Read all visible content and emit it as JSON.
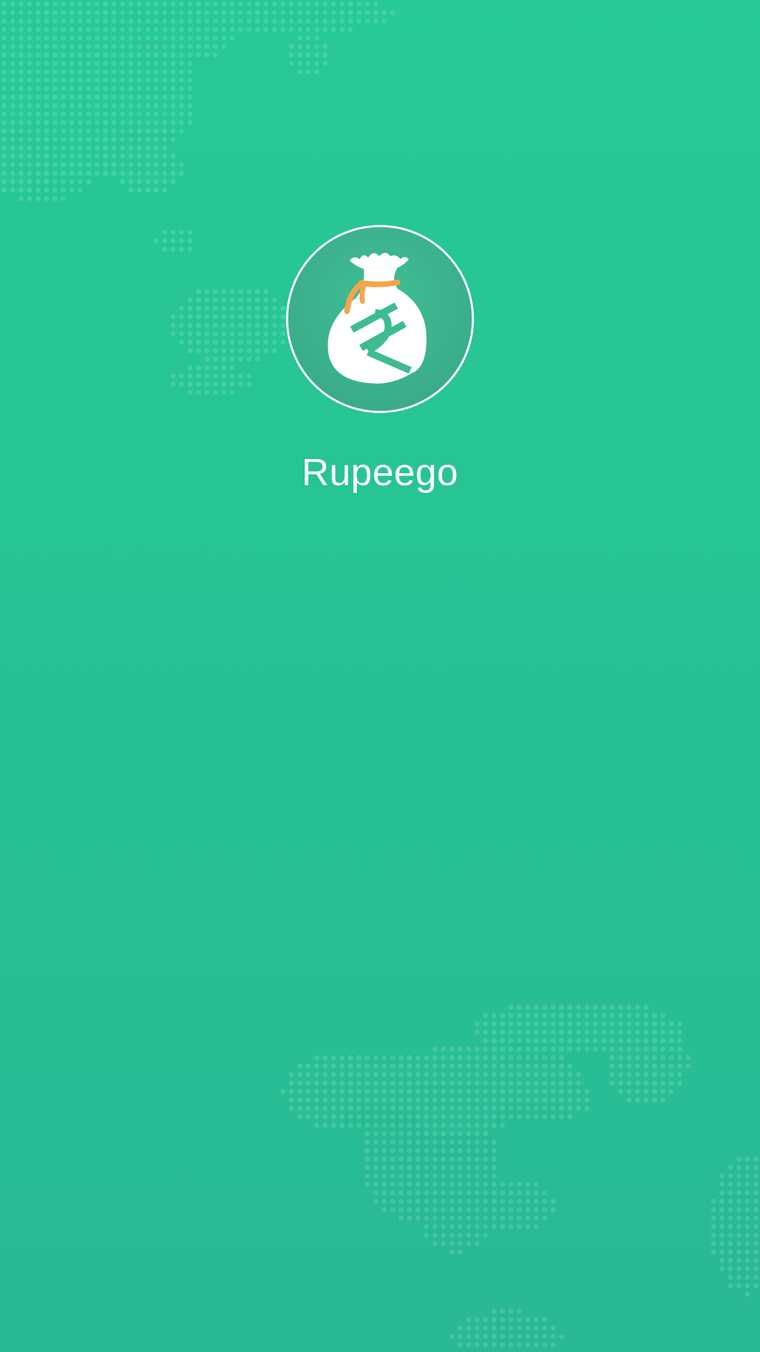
{
  "app": {
    "name": "Rupeego",
    "logo_icon": "money-bag-rupee-icon"
  },
  "colors": {
    "background": "#27c595",
    "logo_circle": "#3dbb92",
    "tie": "#f5a54a",
    "map_dots": "#ffffff"
  },
  "decorations": {
    "top_map": "world-map-dots-icon",
    "bottom_map": "world-map-dots-icon"
  }
}
